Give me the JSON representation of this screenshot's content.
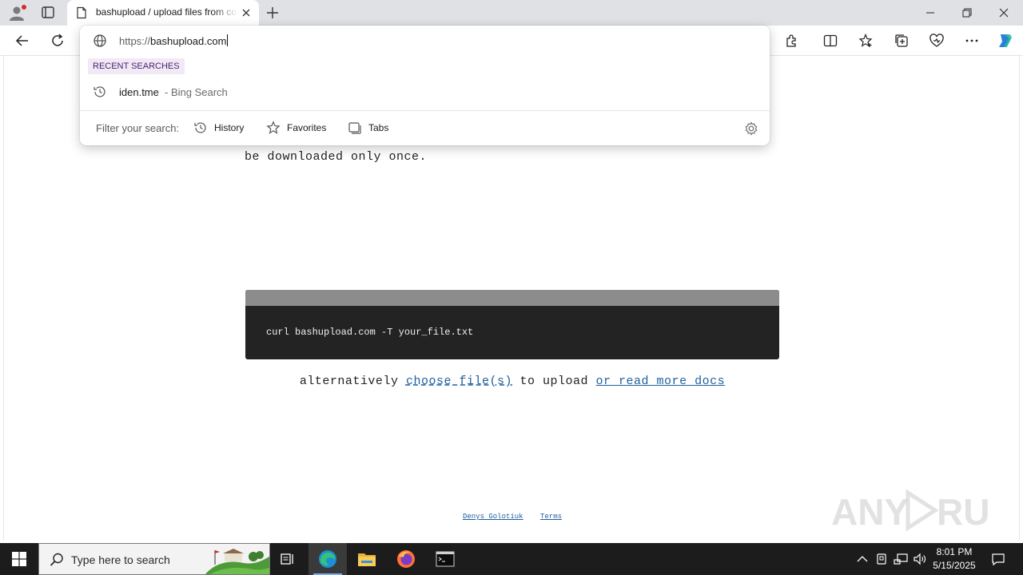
{
  "browser": {
    "tab": {
      "title": "bashupload / upload files from command line"
    },
    "address": {
      "scheme": "https://",
      "host": "bashupload.com"
    }
  },
  "omnibox": {
    "recent_label": "RECENT SEARCHES",
    "suggestion": {
      "text": "iden.tme",
      "source": "- Bing Search"
    },
    "filter_label": "Filter your search:",
    "filters": [
      "History",
      "Favorites",
      "Tabs"
    ]
  },
  "page": {
    "partial_text": "be downloaded only once.",
    "command": "curl bashupload.com -T your_file.txt",
    "alt": {
      "prefix": "alternatively",
      "choose_link": "choose file(s)",
      "middle": "to upload",
      "docs_link": "or read more docs"
    },
    "footer": {
      "author": "Denys Golotiuk",
      "terms": "Terms"
    }
  },
  "taskbar": {
    "search_placeholder": "Type here to search",
    "time": "8:01 PM",
    "date": "5/15/2025"
  },
  "colors": {
    "link": "#1f5f9f",
    "terminal_bg": "#232323",
    "terminal_bar": "#8c8c8c",
    "recent_badge_bg": "#f1eaf6",
    "recent_badge_text": "#4b1f6f"
  }
}
